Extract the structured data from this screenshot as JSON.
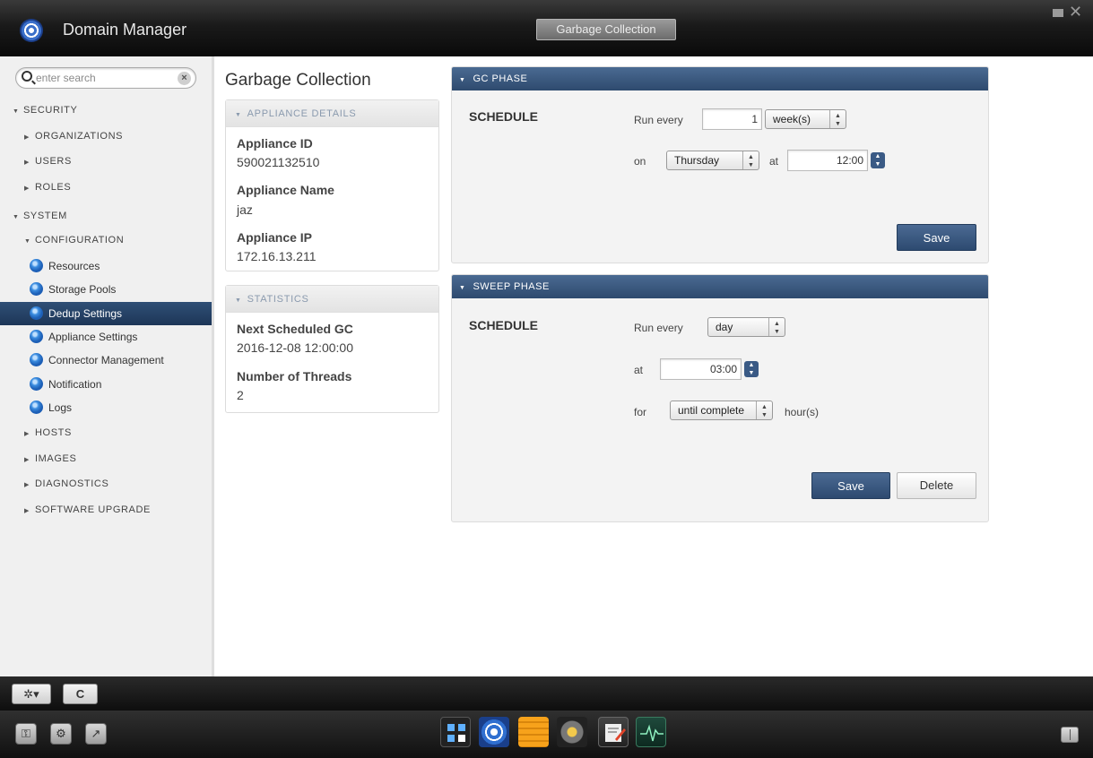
{
  "window": {
    "app_title": "Domain Manager",
    "active_tab": "Garbage Collection"
  },
  "sidebar": {
    "search_placeholder": "enter search",
    "items": [
      {
        "label": "SECURITY",
        "level": 0,
        "state": "expanded"
      },
      {
        "label": "ORGANIZATIONS",
        "level": 1,
        "state": "collapsed"
      },
      {
        "label": "USERS",
        "level": 1,
        "state": "collapsed"
      },
      {
        "label": "ROLES",
        "level": 1,
        "state": "collapsed"
      },
      {
        "label": "SYSTEM",
        "level": 0,
        "state": "expanded"
      },
      {
        "label": "CONFIGURATION",
        "level": 1,
        "state": "expanded"
      },
      {
        "label": "Resources",
        "level": 2,
        "icon": "globe-icon"
      },
      {
        "label": "Storage Pools",
        "level": 2,
        "icon": "globe-icon"
      },
      {
        "label": "Dedup Settings",
        "level": 2,
        "icon": "globe-icon",
        "selected": true
      },
      {
        "label": "Appliance Settings",
        "level": 2,
        "icon": "globe-icon"
      },
      {
        "label": "Connector Management",
        "level": 2,
        "icon": "globe-icon"
      },
      {
        "label": "Notification",
        "level": 2,
        "icon": "globe-icon"
      },
      {
        "label": "Logs",
        "level": 2,
        "icon": "globe-icon"
      },
      {
        "label": "HOSTS",
        "level": 1,
        "state": "collapsed"
      },
      {
        "label": "IMAGES",
        "level": 1,
        "state": "collapsed"
      },
      {
        "label": "DIAGNOSTICS",
        "level": 1,
        "state": "collapsed"
      },
      {
        "label": "SOFTWARE UPGRADE",
        "level": 1,
        "state": "collapsed"
      }
    ]
  },
  "main": {
    "title": "Garbage Collection",
    "appliance_details": {
      "header": "APPLIANCE DETAILS",
      "id_label": "Appliance ID",
      "id_value": "590021132510",
      "name_label": "Appliance Name",
      "name_value": "jaz",
      "ip_label": "Appliance IP",
      "ip_value": "172.16.13.211"
    },
    "statistics": {
      "header": "STATISTICS",
      "next_gc_label": "Next Scheduled GC",
      "next_gc_value": "2016-12-08 12:00:00",
      "threads_label": "Number of Threads",
      "threads_value": "2"
    },
    "gc_phase": {
      "header": "GC PHASE",
      "schedule_label": "SCHEDULE",
      "run_every_label": "Run every",
      "run_every_value": "1",
      "unit": "week(s)",
      "on_label": "on",
      "day": "Thursday",
      "at_label": "at",
      "time": "12:00",
      "save_label": "Save"
    },
    "sweep_phase": {
      "header": "SWEEP PHASE",
      "schedule_label": "SCHEDULE",
      "run_every_label": "Run every",
      "unit": "day",
      "at_label": "at",
      "time": "03:00",
      "for_label": "for",
      "duration": "until complete",
      "hours_label": "hour(s)",
      "save_label": "Save",
      "delete_label": "Delete"
    }
  },
  "toolbar": {
    "settings_icon": "gear-dropdown-icon",
    "refresh_label": "C"
  },
  "dock": {
    "left_icons": [
      "keyhole-icon",
      "gear-icon",
      "wrench-icon"
    ],
    "apps": [
      "grid-app-icon",
      "domain-manager-icon",
      "notes-app-icon",
      "network-app-icon",
      "editor-app-icon",
      "monitor-app-icon"
    ],
    "right_icon": "book-icon"
  },
  "colors": {
    "accent": "#2e4a6e",
    "selected": "#1d3657",
    "panel_bg": "#f3f3f3"
  }
}
